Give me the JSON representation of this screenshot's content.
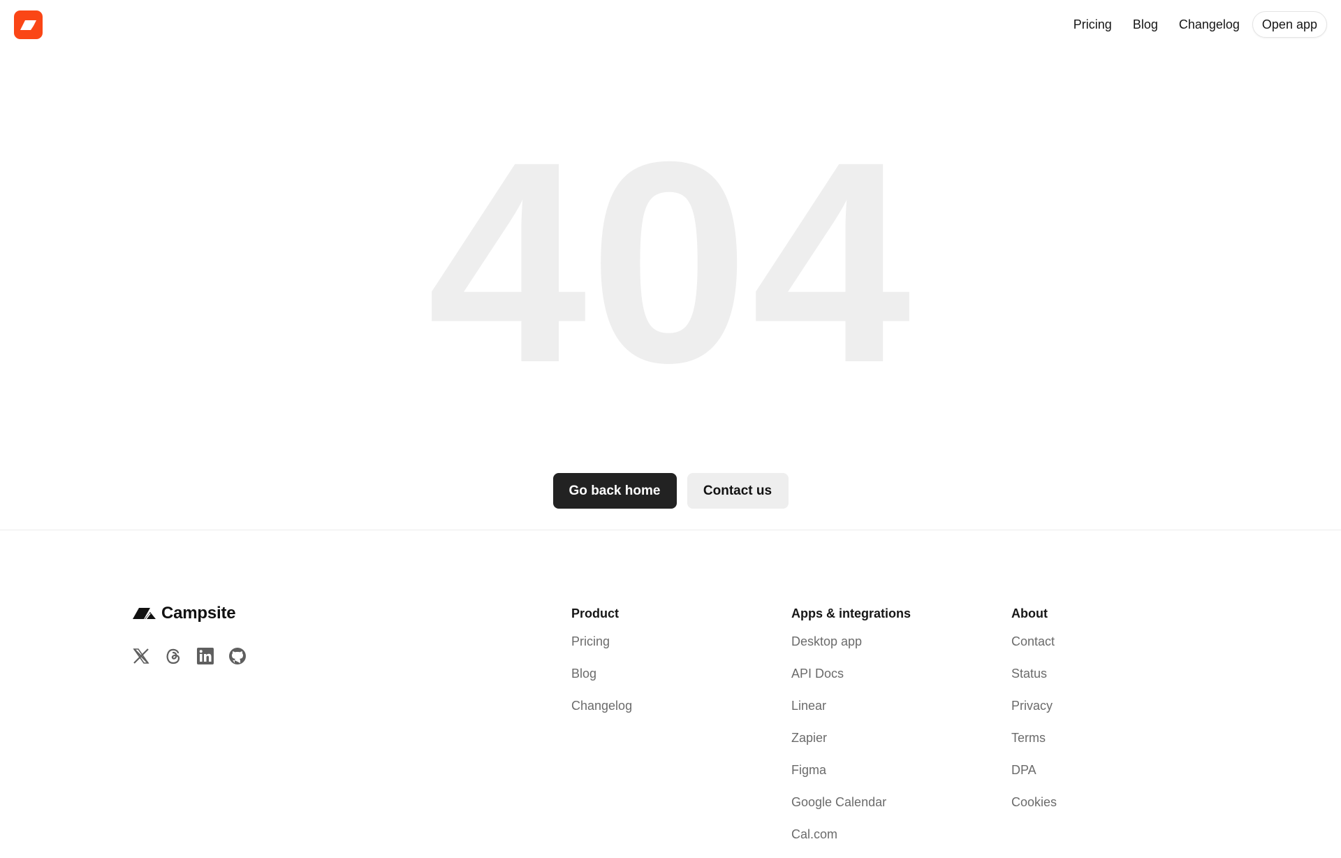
{
  "header": {
    "nav": {
      "pricing": "Pricing",
      "blog": "Blog",
      "changelog": "Changelog",
      "open_app": "Open app"
    }
  },
  "hero": {
    "code": "404",
    "primary_button": "Go back home",
    "secondary_button": "Contact us"
  },
  "footer": {
    "brand": "Campsite",
    "socials": [
      "x-icon",
      "threads-icon",
      "linkedin-icon",
      "github-icon"
    ],
    "columns": [
      {
        "title": "Product",
        "links": [
          "Pricing",
          "Blog",
          "Changelog"
        ]
      },
      {
        "title": "Apps & integrations",
        "links": [
          "Desktop app",
          "API Docs",
          "Linear",
          "Zapier",
          "Figma",
          "Google Calendar",
          "Cal.com"
        ]
      },
      {
        "title": "About",
        "links": [
          "Contact",
          "Status",
          "Privacy",
          "Terms",
          "DPA",
          "Cookies"
        ]
      }
    ]
  },
  "colors": {
    "brand": "#fa4616",
    "primary_button": "#222222",
    "secondary_button": "#eeeeee",
    "big_text": "#eeeeee"
  }
}
